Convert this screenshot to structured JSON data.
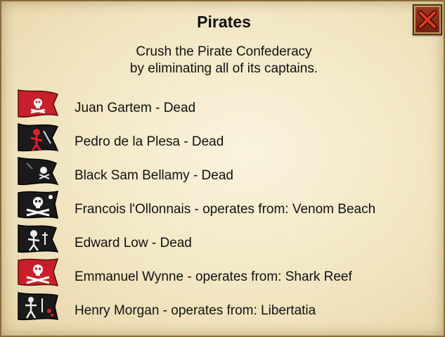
{
  "dialog": {
    "title": "Pirates",
    "description_lines": [
      "Crush the Pirate Confederacy",
      "by eliminating all of its captains."
    ]
  },
  "captains": [
    {
      "label": "Juan Gartem - Dead",
      "flag_icon": "pirate-flag-red-skull-icon",
      "flag_color": "#c8202a"
    },
    {
      "label": "Pedro de la Plesa - Dead",
      "flag_icon": "pirate-flag-black-red-skeleton-icon",
      "flag_color": "#1a1a1a"
    },
    {
      "label": "Black Sam Bellamy - Dead",
      "flag_icon": "pirate-flag-black-skull-icon",
      "flag_color": "#1a1a1a"
    },
    {
      "label": "Francois l'Ollonnais - operates from: Venom Beach",
      "flag_icon": "pirate-flag-black-skull-crossbones-icon",
      "flag_color": "#1a1a1a"
    },
    {
      "label": "Edward Low - Dead",
      "flag_icon": "pirate-flag-black-skeleton-icon",
      "flag_color": "#1a1a1a"
    },
    {
      "label": "Emmanuel Wynne - operates from: Shark Reef",
      "flag_icon": "pirate-flag-red-skull-crossbones-icon",
      "flag_color": "#c8202a"
    },
    {
      "label": "Henry Morgan - operates from: Libertatia",
      "flag_icon": "pirate-flag-black-figure-icon",
      "flag_color": "#1a1a1a"
    }
  ],
  "close_icon": "close-icon",
  "colors": {
    "red_flag": "#c8202a",
    "black_flag": "#1a1a1a",
    "close_button": "#8e2c18"
  }
}
